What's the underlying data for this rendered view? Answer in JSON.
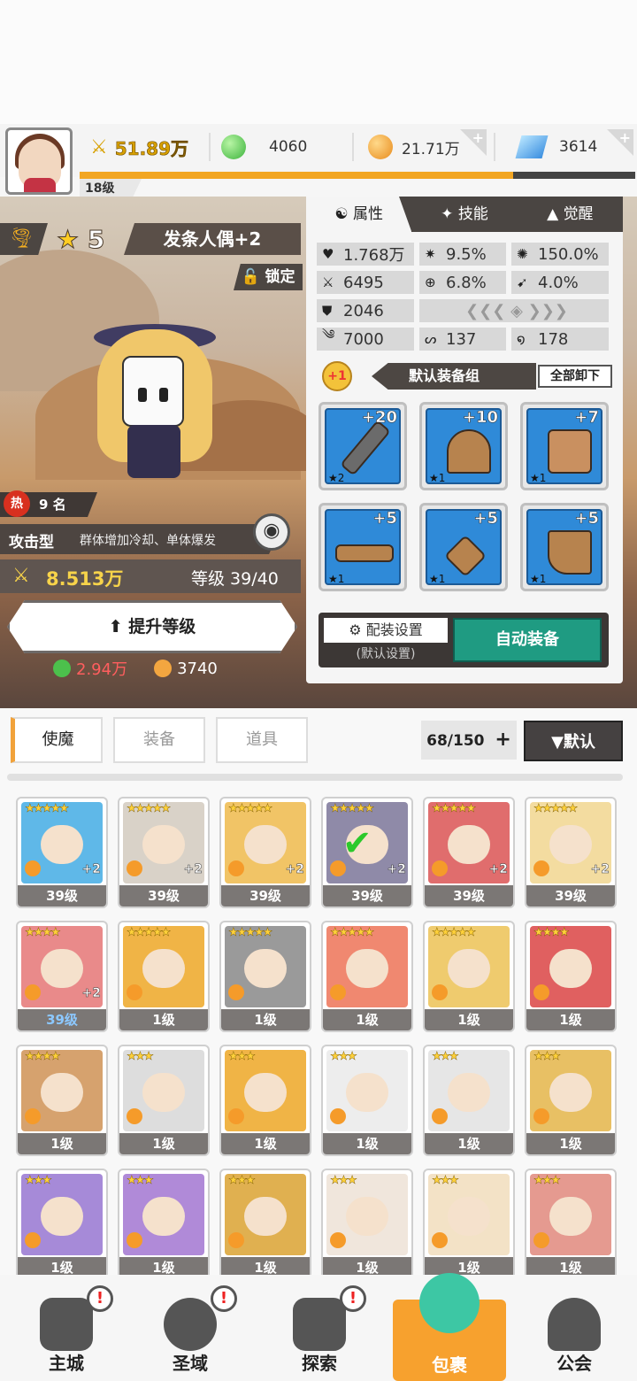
{
  "player": {
    "level_label": "18级",
    "power": "51.89万",
    "green_currency": "4060",
    "gold_currency": "21.71万",
    "diamond_currency": "3614",
    "xp_fraction": 0.78
  },
  "hero": {
    "stars": "5",
    "name": "发条人偶+2",
    "lock_label": "锁定",
    "hot_rank": "9 名",
    "hot_label": "热",
    "type": "攻击型",
    "type_desc": "群体增加冷却、单体爆发",
    "power": "8.513万",
    "level": "等级 39/40",
    "upgrade_label": "提升等级",
    "cost_green": "2.94万",
    "cost_gold": "3740"
  },
  "panel": {
    "tabs": [
      "属性",
      "技能",
      "觉醒"
    ],
    "stats": {
      "hp": "1.768万",
      "crit": "9.5%",
      "crit_dmg": "150.0%",
      "atk": "6495",
      "accuracy": "6.8%",
      "dodge": "4.0%",
      "def": "2046",
      "speed": "7000",
      "stat_a": "137",
      "stat_b": "178"
    },
    "equip_group": {
      "plus_badge": "+1",
      "name": "默认装备组",
      "unequip_all": "全部卸下"
    },
    "slots": [
      {
        "plus": "+20",
        "star": "★2",
        "name": "sword"
      },
      {
        "plus": "+10",
        "star": "★1",
        "name": "helmet"
      },
      {
        "plus": "+7",
        "star": "★1",
        "name": "armor"
      },
      {
        "plus": "+5",
        "star": "★1",
        "name": "belt"
      },
      {
        "plus": "+5",
        "star": "★1",
        "name": "necklace"
      },
      {
        "plus": "+5",
        "star": "★1",
        "name": "boots"
      }
    ],
    "config_label": "配装设置",
    "config_sub": "(默认设置)",
    "auto_equip": "自动装备"
  },
  "list": {
    "tabs": [
      "使魔",
      "装备",
      "道具"
    ],
    "count": "68/150",
    "count_plus": "+",
    "sort": "▼默认",
    "cards": [
      {
        "stars": "★★★★★",
        "level": "39级",
        "plus": "+2",
        "color": "#5fb8e8"
      },
      {
        "stars": "★★★★★",
        "level": "39级",
        "plus": "+2",
        "color": "#d9d2c8"
      },
      {
        "stars": "★★★★★",
        "level": "39级",
        "plus": "+2",
        "color": "#f1c466"
      },
      {
        "stars": "★★★★★",
        "level": "39级",
        "plus": "+2",
        "color": "#8f8aa8"
      },
      {
        "stars": "★★★★★",
        "level": "39级",
        "plus": "+2",
        "color": "#e06d6d"
      },
      {
        "stars": "★★★★★",
        "level": "39级",
        "plus": "+2",
        "color": "#f3dca0"
      },
      {
        "stars": "★★★★",
        "level": "39级",
        "plus": "+2",
        "color": "#e98a8a"
      },
      {
        "stars": "★★★★★",
        "level": "1级",
        "plus": "",
        "color": "#f0b446"
      },
      {
        "stars": "★★★★★",
        "level": "1级",
        "plus": "",
        "color": "#9a9a9a"
      },
      {
        "stars": "★★★★★",
        "level": "1级",
        "plus": "",
        "color": "#f08870"
      },
      {
        "stars": "★★★★★",
        "level": "1级",
        "plus": "",
        "color": "#efcb6e"
      },
      {
        "stars": "★★★★",
        "level": "1级",
        "plus": "",
        "color": "#e06060"
      },
      {
        "stars": "★★★★",
        "level": "1级",
        "plus": "",
        "color": "#d6a26e"
      },
      {
        "stars": "★★★",
        "level": "1级",
        "plus": "",
        "color": "#dddddd"
      },
      {
        "stars": "★★★",
        "level": "1级",
        "plus": "",
        "color": "#f0b446"
      },
      {
        "stars": "★★★",
        "level": "1级",
        "plus": "",
        "color": "#ededed"
      },
      {
        "stars": "★★★",
        "level": "1级",
        "plus": "",
        "color": "#e6e6e6"
      },
      {
        "stars": "★★★",
        "level": "1级",
        "plus": "",
        "color": "#e8c064"
      },
      {
        "stars": "★★★",
        "level": "1级",
        "plus": "",
        "color": "#a68ad8"
      },
      {
        "stars": "★★★",
        "level": "1级",
        "plus": "",
        "color": "#b08ad8"
      },
      {
        "stars": "★★★",
        "level": "1级",
        "plus": "",
        "color": "#e0b050"
      },
      {
        "stars": "★★★",
        "level": "1级",
        "plus": "",
        "color": "#f0e6dc"
      },
      {
        "stars": "★★★",
        "level": "1级",
        "plus": "",
        "color": "#f3e2c6"
      },
      {
        "stars": "★★★",
        "level": "1级",
        "plus": "",
        "color": "#e59a90"
      }
    ]
  },
  "nav": [
    {
      "label": "主城",
      "alert": "!"
    },
    {
      "label": "圣域",
      "alert": "!"
    },
    {
      "label": "探索",
      "alert": "!"
    },
    {
      "label": "包裹",
      "alert": ""
    },
    {
      "label": "公会",
      "alert": ""
    }
  ]
}
